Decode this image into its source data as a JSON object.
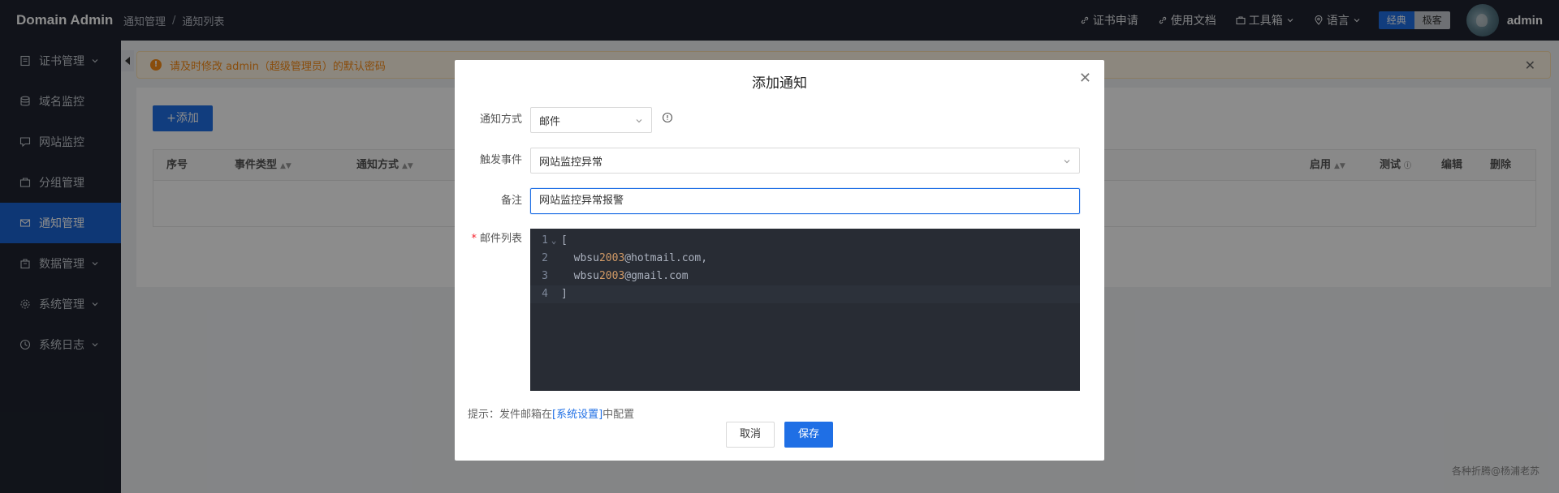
{
  "app": {
    "brand": "Domain Admin"
  },
  "breadcrumb": [
    "通知管理",
    "通知列表"
  ],
  "topnav": {
    "cert_apply": "证书申请",
    "docs": "使用文档",
    "toolbox": "工具箱",
    "language": "语言",
    "theme_classic": "经典",
    "theme_minimal": "极客",
    "user": "admin"
  },
  "sidebar": {
    "items": [
      {
        "label": "证书管理",
        "icon": "certificate-icon",
        "has_children": true
      },
      {
        "label": "域名监控",
        "icon": "database-icon",
        "has_children": false
      },
      {
        "label": "网站监控",
        "icon": "monitor-icon",
        "has_children": false
      },
      {
        "label": "分组管理",
        "icon": "folder-icon",
        "has_children": false
      },
      {
        "label": "通知管理",
        "icon": "mail-icon",
        "has_children": false,
        "active": true
      },
      {
        "label": "数据管理",
        "icon": "package-icon",
        "has_children": true
      },
      {
        "label": "系统管理",
        "icon": "gear-icon",
        "has_children": true
      },
      {
        "label": "系统日志",
        "icon": "clock-icon",
        "has_children": true
      }
    ]
  },
  "notice": {
    "text": "请及时修改 admin（超级管理员）的默认密码"
  },
  "main": {
    "add_button": "+添加",
    "table_headers": [
      "序号",
      "事件类型",
      "通知方式",
      "启用",
      "测试",
      "编辑",
      "删除"
    ]
  },
  "modal": {
    "title": "添加通知",
    "notify_method_label": "通知方式",
    "notify_method_value": "邮件",
    "trigger_event_label": "触发事件",
    "trigger_event_value": "网站监控异常",
    "remark_label": "备注",
    "remark_value": "网站监控异常报警",
    "email_list_label": "邮件列表",
    "email_list_required_mark": "*",
    "code_lines": [
      {
        "no": "1",
        "pre": "[",
        "num": "",
        "post": ""
      },
      {
        "no": "2",
        "pre": "  wbsu",
        "num": "2003",
        "post": "@hotmail.com,"
      },
      {
        "no": "3",
        "pre": "  wbsu",
        "num": "2003",
        "post": "@gmail.com"
      },
      {
        "no": "4",
        "pre": "]",
        "num": "",
        "post": ""
      }
    ],
    "hint_prefix": "提示：发件邮箱在",
    "hint_link": "[系统设置]",
    "hint_suffix": "中配置",
    "cancel_button": "取消",
    "save_button": "保存"
  },
  "footer": {
    "text": "各种折腾@杨浦老苏"
  },
  "colors": {
    "primary": "#1f6fe5",
    "sidebar_bg": "#1f2430",
    "editor_bg": "#282c34",
    "warning": "#fa8c16"
  }
}
